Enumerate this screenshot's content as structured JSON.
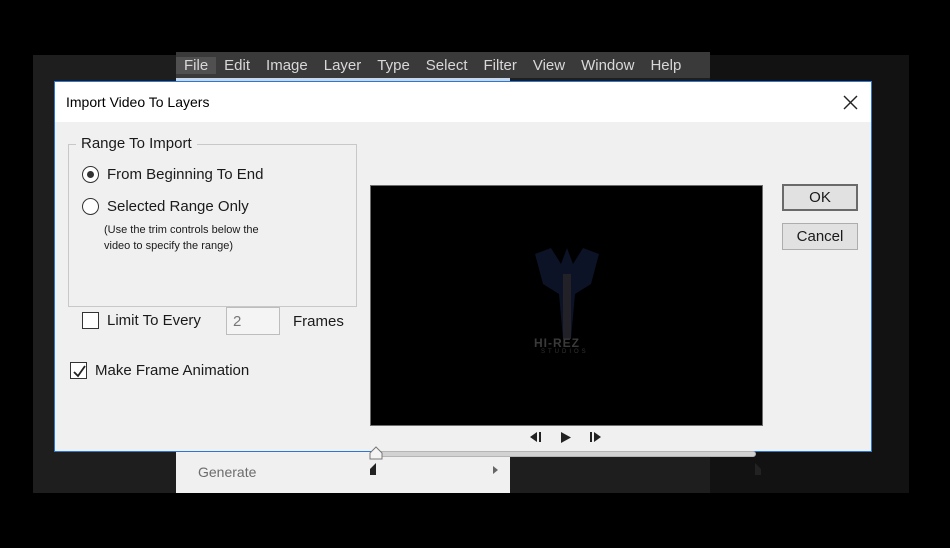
{
  "menubar": {
    "items": [
      "File",
      "Edit",
      "Image",
      "Layer",
      "Type",
      "Select",
      "Filter",
      "View",
      "Window",
      "Help"
    ],
    "active": "File"
  },
  "background_menu": {
    "generate_label": "Generate"
  },
  "dialog": {
    "title": "Import Video To Layers",
    "range_group": {
      "legend": "Range To Import",
      "option_from_beginning": "From Beginning To End",
      "option_selected_range": "Selected Range Only",
      "hint_line1": "(Use the trim controls below the",
      "hint_line2": "video to specify the range)",
      "selected": "From Beginning To End",
      "limit_label": "Limit To Every",
      "limit_checked": false,
      "limit_value": "2",
      "frames_label": "Frames"
    },
    "make_frame_animation": {
      "label": "Make Frame Animation",
      "checked": true
    },
    "buttons": {
      "ok": "OK",
      "cancel": "Cancel"
    },
    "video": {
      "logo_text": "HI-REZ",
      "logo_subtext": "STUDIOS"
    },
    "icons": {
      "close": "close-icon",
      "step_back": "step-back-icon",
      "play": "play-icon",
      "step_forward": "step-forward-icon"
    },
    "accent_color": "#2b77d6"
  }
}
